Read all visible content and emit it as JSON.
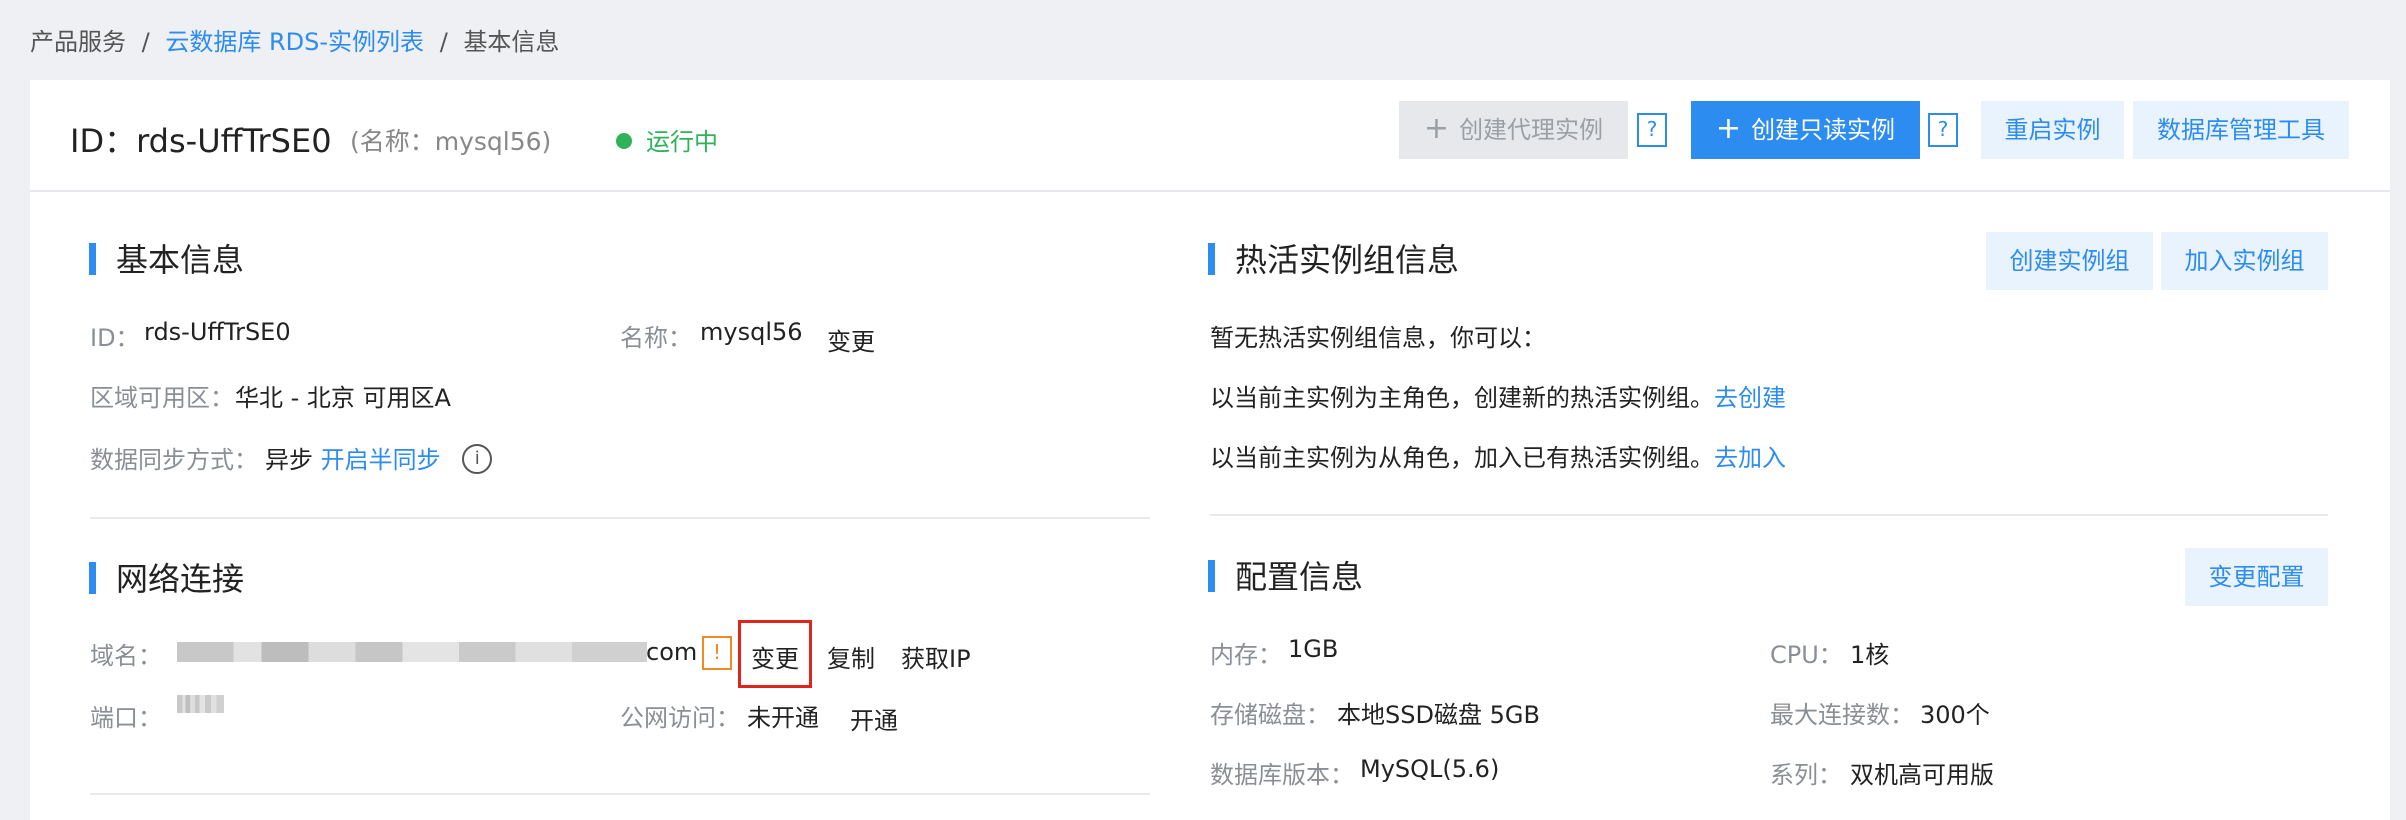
{
  "breadcrumb": {
    "items": [
      "产品服务",
      "/",
      "云数据库 RDS-实例列表",
      "/",
      "基本信息"
    ]
  },
  "header": {
    "title": "ID：rds-UffTrSE0",
    "subtitle": "(名称：mysql56)",
    "status": "运行中",
    "buttons": {
      "create_proxy": "创建代理实例",
      "create_readonly": "创建只读实例",
      "restart": "重启实例",
      "db_tool": "数据库管理工具",
      "help": "?"
    }
  },
  "basic": {
    "title": "基本信息",
    "id_label": "ID：",
    "id_value": "rds-UffTrSE0",
    "name_label": "名称：",
    "name_value": "mysql56",
    "name_change": "变更",
    "zone_label": "区域可用区：",
    "zone_value": "华北 - 北京 可用区A",
    "sync_label": "数据同步方式：",
    "sync_value": "异步",
    "sync_action": "开启半同步",
    "info_icon": "i"
  },
  "network": {
    "title": "网络连接",
    "domain_label": "域名：",
    "domain_suffix": "com",
    "warn_icon": "!",
    "change": "变更",
    "copy": "复制",
    "get_ip": "获取IP",
    "port_label": "端口：",
    "public_label": "公网访问：",
    "public_value": "未开通",
    "open": "开通"
  },
  "hotgroup": {
    "title": "热活实例组信息",
    "create_group": "创建实例组",
    "join_group": "加入实例组",
    "line1": "暂无热活实例组信息，你可以：",
    "line2": "以当前主实例为主角色，创建新的热活实例组。",
    "line2_link": "去创建",
    "line3": "以当前主实例为从角色，加入已有热活实例组。",
    "line3_link": "去加入"
  },
  "config": {
    "title": "配置信息",
    "change_config": "变更配置",
    "memory_label": "内存：",
    "memory_value": "1GB",
    "cpu_label": "CPU：",
    "cpu_value": "1核",
    "disk_label": "存储磁盘：",
    "disk_value": "本地SSD磁盘 5GB",
    "maxconn_label": "最大连接数：",
    "maxconn_value": "300个",
    "version_label": "数据库版本：",
    "version_value": "MySQL(5.6)",
    "series_label": "系列：",
    "series_value": "双机高可用版"
  },
  "colors": {
    "accent": "#2d8cf0",
    "success": "#2fb35a",
    "warning": "#f08a24",
    "highlight": "#e0261c"
  }
}
